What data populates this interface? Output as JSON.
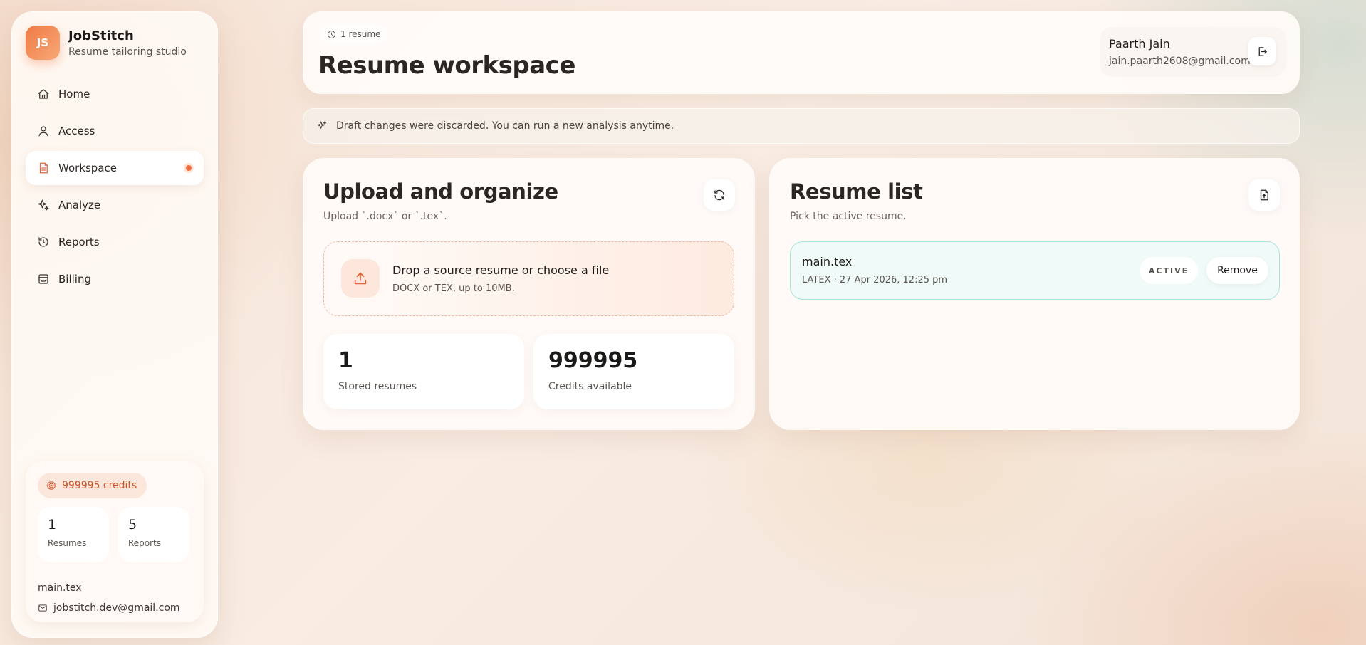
{
  "brand": {
    "logo": "JS",
    "name": "JobStitch",
    "subtitle": "Resume tailoring studio"
  },
  "nav": {
    "items": [
      {
        "label": "Home",
        "icon": "home-icon"
      },
      {
        "label": "Access",
        "icon": "user-icon"
      },
      {
        "label": "Workspace",
        "icon": "document-icon",
        "active": true
      },
      {
        "label": "Analyze",
        "icon": "sparkle-icon"
      },
      {
        "label": "Reports",
        "icon": "history-icon"
      },
      {
        "label": "Billing",
        "icon": "billing-icon"
      }
    ]
  },
  "sidebar_card": {
    "credits": "999995 credits",
    "resumes_count": "1",
    "resumes_label": "Resumes",
    "reports_count": "5",
    "reports_label": "Reports",
    "file": "main.tex",
    "email": "jobstitch.dev@gmail.com"
  },
  "header": {
    "resume_count": "1 resume",
    "title": "Resume workspace",
    "user_name": "Paarth Jain",
    "user_email": "jain.paarth2608@gmail.com"
  },
  "notice": {
    "text": "Draft changes were discarded. You can run a new analysis anytime."
  },
  "upload": {
    "title": "Upload and organize",
    "subtitle": "Upload `.docx` or `.tex`.",
    "drop_title": "Drop a source resume or choose a file",
    "drop_subtitle": "DOCX or TEX, up to 10MB.",
    "stored_count": "1",
    "stored_label": "Stored resumes",
    "credits_count": "999995",
    "credits_label": "Credits available"
  },
  "resume_list": {
    "title": "Resume list",
    "subtitle": "Pick the active resume.",
    "items": [
      {
        "name": "main.tex",
        "meta": "LATEX · 27 Apr 2026, 12:25 pm",
        "badge": "ACTIVE",
        "remove_label": "Remove"
      }
    ]
  },
  "colors": {
    "accent": "#ec6a3a",
    "active_border": "#a6e4da"
  }
}
